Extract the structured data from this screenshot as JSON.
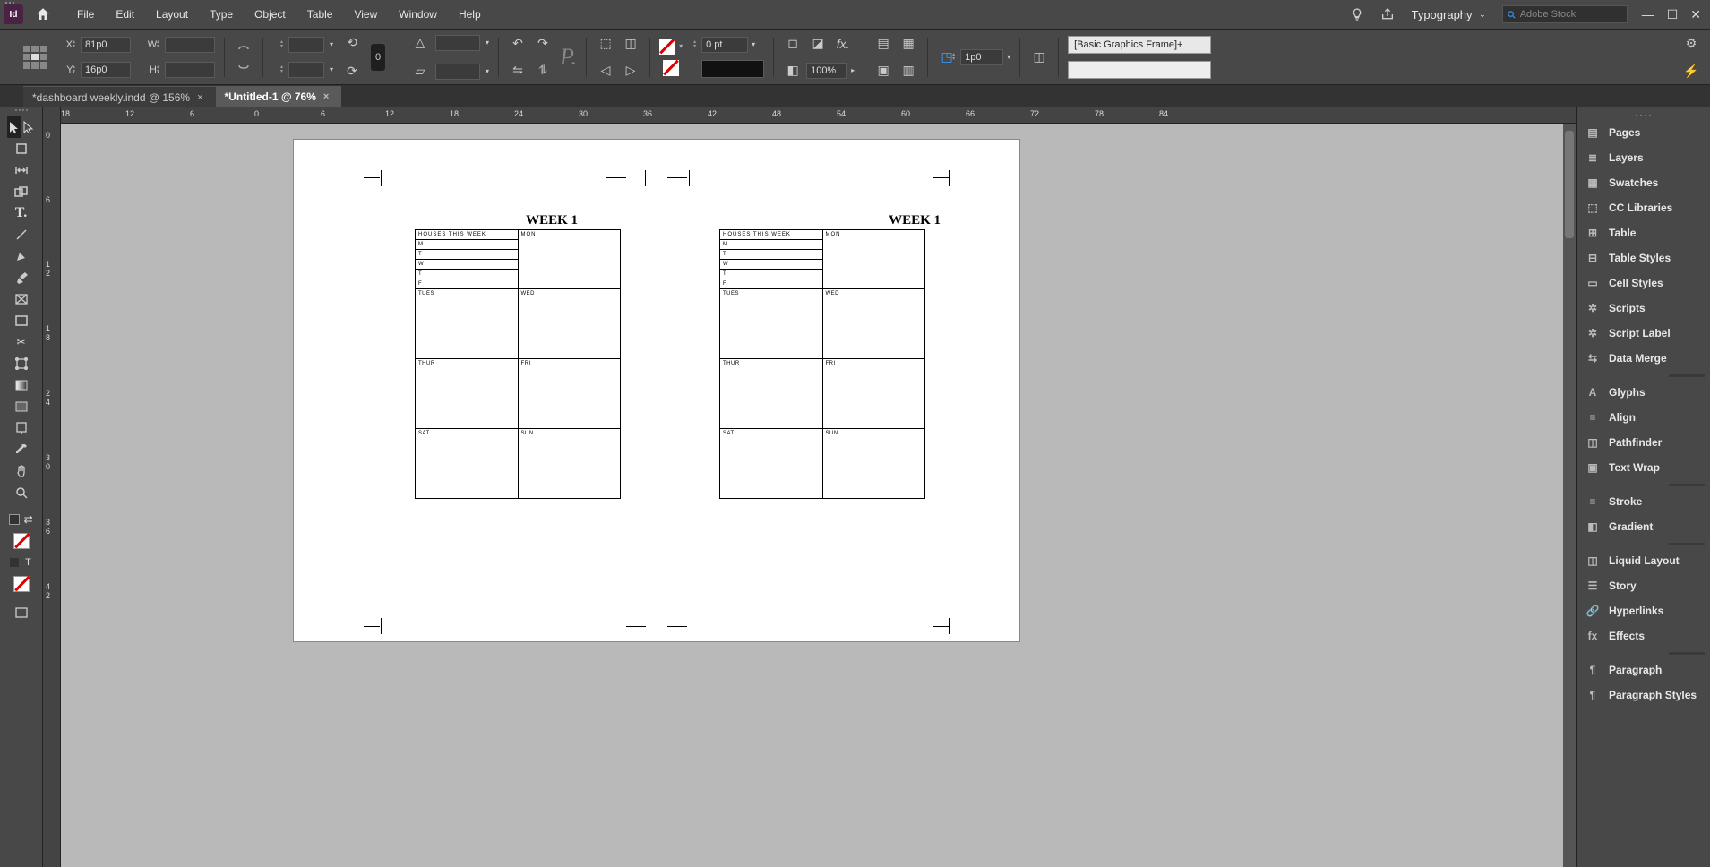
{
  "menubar": {
    "items": [
      "File",
      "Edit",
      "Layout",
      "Type",
      "Object",
      "Table",
      "View",
      "Window",
      "Help"
    ],
    "workspace": "Typography",
    "stock_placeholder": "Adobe Stock"
  },
  "controlbar": {
    "x_label": "X:",
    "x_value": "81p0",
    "y_label": "Y:",
    "y_value": "16p0",
    "w_label": "W:",
    "w_value": "",
    "h_label": "H:",
    "h_value": "",
    "stroke_weight": "0 pt",
    "opacity": "100%",
    "ref_value": "1p0",
    "style_name": "[Basic Graphics Frame]+"
  },
  "tabs": [
    {
      "title": "*dashboard weekly.indd @ 156%"
    },
    {
      "title": "*Untitled-1 @ 76%"
    }
  ],
  "hruler_ticks": [
    "18",
    "12",
    "6",
    "0",
    "6",
    "12",
    "18",
    "24",
    "30",
    "36",
    "42",
    "48",
    "54",
    "60",
    "66",
    "72",
    "78",
    "84"
  ],
  "vruler_ticks": [
    "0",
    "6",
    "1\n2",
    "1\n8",
    "2\n4",
    "3\n0",
    "3\n6",
    "4\n2"
  ],
  "planner": {
    "title": "WEEK 1",
    "houses_hdr": "HOUSES THIS WEEK",
    "mon": "MON",
    "rows": [
      "M",
      "T",
      "W",
      "T",
      "F"
    ],
    "tues": "TUES",
    "wed": "WED",
    "thur": "THUR",
    "fri": "FRI",
    "sat": "SAT",
    "sun": "SUN"
  },
  "panels": {
    "g1": [
      "Pages",
      "Layers",
      "Swatches",
      "CC Libraries",
      "Table",
      "Table Styles",
      "Cell Styles",
      "Scripts",
      "Script Label",
      "Data Merge"
    ],
    "g2": [
      "Glyphs",
      "Align",
      "Pathfinder",
      "Text Wrap"
    ],
    "g3": [
      "Stroke",
      "Gradient"
    ],
    "g4": [
      "Liquid Layout",
      "Story",
      "Hyperlinks",
      "Effects"
    ],
    "g5": [
      "Paragraph",
      "Paragraph Styles"
    ]
  }
}
